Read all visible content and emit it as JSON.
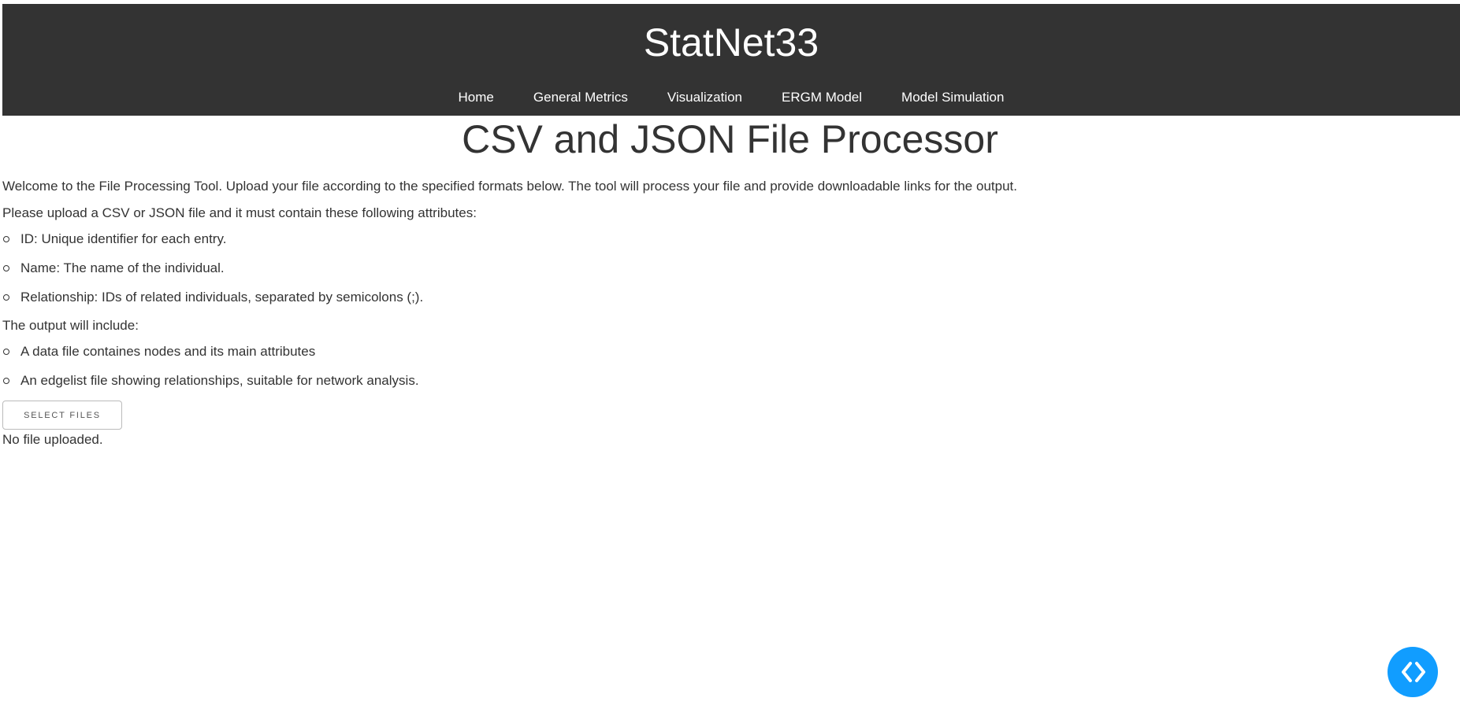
{
  "header": {
    "site_title": "StatNet33",
    "nav": [
      {
        "label": "Home"
      },
      {
        "label": "General Metrics"
      },
      {
        "label": "Visualization"
      },
      {
        "label": "ERGM Model"
      },
      {
        "label": "Model Simulation"
      }
    ]
  },
  "main": {
    "title": "CSV and JSON File Processor",
    "intro": "Welcome to the File Processing Tool. Upload your file according to the specified formats below. The tool will process your file and provide downloadable links for the output.",
    "requirements_intro": "Please upload a CSV or JSON file and it must contain these following attributes:",
    "requirements": [
      {
        "text": "ID: Unique identifier for each entry."
      },
      {
        "text": "Name: The name of the individual."
      },
      {
        "text": "Relationship: IDs of related individuals, separated by semicolons (;)."
      }
    ],
    "output_intro": "The output will include:",
    "outputs": [
      {
        "text": "A data file containes nodes and its main attributes"
      },
      {
        "text": "An edgelist file showing relationships, suitable for network analysis."
      }
    ],
    "upload_button_label": "Select Files",
    "upload_status": "No file uploaded."
  },
  "debug_button": {
    "icon": "code-brackets-icon",
    "color": "#119dff"
  },
  "colors": {
    "header_bg": "#333333",
    "text": "#333333",
    "accent": "#119dff"
  }
}
